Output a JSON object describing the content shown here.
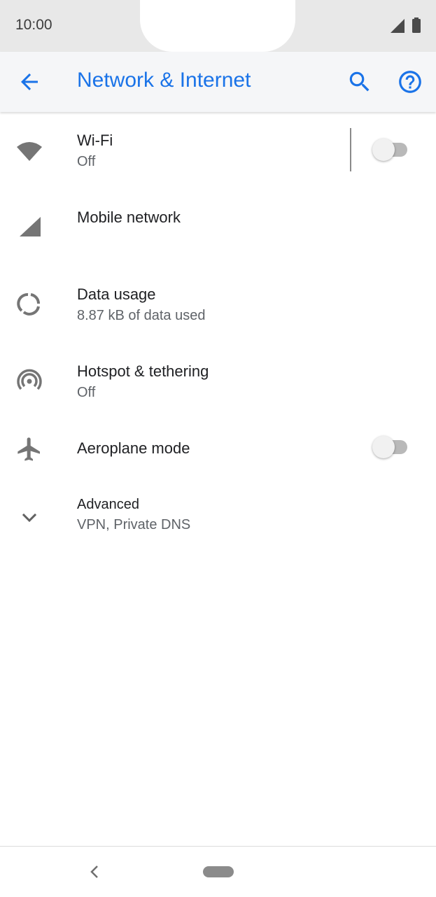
{
  "status_bar": {
    "time": "10:00"
  },
  "app_bar": {
    "title": "Network & Internet"
  },
  "items": [
    {
      "title": "Wi-Fi",
      "subtitle": "Off",
      "icon": "wifi-icon",
      "toggle": "off"
    },
    {
      "title": "Mobile network",
      "icon": "signal-icon"
    },
    {
      "title": "Data usage",
      "subtitle": "8.87 kB of data used",
      "icon": "data-usage-icon"
    },
    {
      "title": "Hotspot & tethering",
      "subtitle": "Off",
      "icon": "hotspot-icon"
    },
    {
      "title": "Aeroplane mode",
      "icon": "airplane-icon",
      "toggle": "off"
    },
    {
      "title": "Advanced",
      "subtitle": "VPN, Private DNS",
      "icon": "chevron-down-icon"
    }
  ],
  "colors": {
    "accent": "#1a73e8",
    "icon": "#757575",
    "text_primary": "#202124",
    "text_secondary": "#5f6368"
  }
}
